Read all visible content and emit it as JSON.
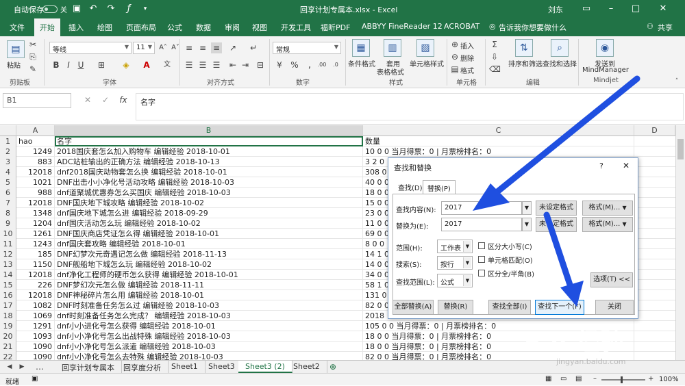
{
  "titlebar": {
    "autosave": "自动保存",
    "autosave_state": "关",
    "title": "回享计划专属本.xlsx  -  Excel",
    "user": "刘东"
  },
  "menu": {
    "tabs": [
      "文件",
      "开始",
      "插入",
      "绘图",
      "页面布局",
      "公式",
      "数据",
      "审阅",
      "视图",
      "开发工具",
      "福昕PDF",
      "ABBYY FineReader 12",
      "ACROBAT"
    ],
    "tell_me": "告诉我你想要做什么",
    "share": "共享",
    "active": "开始"
  },
  "ribbon": {
    "paste": "粘贴",
    "clipboard": "剪贴板",
    "font_name": "等线",
    "font_size": "11",
    "font_group": "字体",
    "align_group": "对齐方式",
    "number_format": "常规",
    "number_group": "数字",
    "conditional": "条件格式",
    "table_format_1": "套用",
    "table_format_2": "表格格式",
    "cell_style": "单元格样式",
    "style_group": "样式",
    "insert": "插入",
    "delete": "删除",
    "format": "格式",
    "cells_group": "单元格",
    "sort": "排序和筛选",
    "find": "查找和选择",
    "edit_group": "编辑",
    "send_1": "发送到",
    "send_2": "MindManager",
    "mindjet_group": "Mindjet"
  },
  "formula": {
    "namebox": "B1",
    "fx": "fx",
    "content": "名字"
  },
  "columns": [
    "A",
    "B",
    "C",
    "D"
  ],
  "header_row": {
    "a": "hao",
    "b": "名字",
    "c": "数量"
  },
  "rows": [
    {
      "n": "2",
      "a": "1249",
      "b": "2018国庆套怎么加入购物车 编辑经验 2018-10-01",
      "c": "10 0 0 当月得票：0 | 月票榜排名：0"
    },
    {
      "n": "3",
      "a": "883",
      "b": "ADC站桩输出的正确方法 编辑经验 2018-10-13",
      "c": "3 2 0"
    },
    {
      "n": "4",
      "a": "12018",
      "b": "dnf2018国庆动物套怎么换 编辑经验 2018-10-01",
      "c": "308 0"
    },
    {
      "n": "5",
      "a": "1021",
      "b": "DNF出击小小净化号活动攻略 编辑经验 2018-10-03",
      "c": "40 0 0"
    },
    {
      "n": "6",
      "a": "988",
      "b": "dnf道聚城优惠券怎么买国庆 编辑经验 2018-10-03",
      "c": "18 0 0"
    },
    {
      "n": "7",
      "a": "12018",
      "b": "DNF国庆地下城攻略 编辑经验 2018-10-02",
      "c": "15 0 0"
    },
    {
      "n": "8",
      "a": "1348",
      "b": "dnf国庆地下城怎么进 编辑经验 2018-09-29",
      "c": "23 0 0"
    },
    {
      "n": "9",
      "a": "1204",
      "b": "dnf国庆活动怎么玩 编辑经验 2018-10-02",
      "c": "11 0 0"
    },
    {
      "n": "10",
      "a": "1261",
      "b": "DNF国庆商店凭证怎么得 编辑经验 2018-10-01",
      "c": "69 0 0"
    },
    {
      "n": "11",
      "a": "1243",
      "b": "dnf国庆套攻略 编辑经验 2018-10-01",
      "c": "8 0 0"
    },
    {
      "n": "12",
      "a": "185",
      "b": "DNF幻梦次元奇遇记怎么做 编辑经验 2018-11-13",
      "c": "14 1 0"
    },
    {
      "n": "13",
      "a": "1150",
      "b": "DNF舰船地下城怎么玩 编辑经验 2018-10-02",
      "c": "14 0 0"
    },
    {
      "n": "14",
      "a": "12018",
      "b": "dnf净化工程师的硬币怎么获得 编辑经验 2018-10-01",
      "c": "34 0 0"
    },
    {
      "n": "15",
      "a": "226",
      "b": "DNF梦幻次元怎么做 编辑经验 2018-11-11",
      "c": "58 1 0"
    },
    {
      "n": "16",
      "a": "12018",
      "b": "DNF神秘碎片怎么用 编辑经验 2018-10-01",
      "c": "131 0"
    },
    {
      "n": "17",
      "a": "1082",
      "b": "DNF时刻准备任务怎么过 编辑经验 2018-10-03",
      "c": "82 0 0"
    },
    {
      "n": "18",
      "a": "1069",
      "b": "dnf时刻准备任务怎么完成？ 编辑经验 2018-10-03",
      "c": "2018"
    },
    {
      "n": "19",
      "a": "1291",
      "b": "dnf小小进化号怎么获得 编辑经验 2018-10-01",
      "c": "105 0 0 当月得票：0 | 月票榜排名：0"
    },
    {
      "n": "20",
      "a": "1093",
      "b": "dnf小小净化号怎么出战特殊 编辑经验 2018-10-03",
      "c": "18 0 0 当月得票：0 | 月票榜排名：0"
    },
    {
      "n": "21",
      "a": "1090",
      "b": "dnf小小净化号怎么派遣 编辑经验 2018-10-03",
      "c": "18 0 0 当月得票：0 | 月票榜排名：0"
    },
    {
      "n": "22",
      "a": "1090",
      "b": "dnf小小净化号怎么去特殊 编辑经验 2018-10-03",
      "c": "82 0 0 当月得票：0 | 月票榜排名：0"
    }
  ],
  "sheets": [
    "回享计划专属本",
    "回享度分析",
    "Sheet1",
    "Sheet3",
    "Sheet3 (2)",
    "Sheet2"
  ],
  "active_sheet": "Sheet3 (2)",
  "status": {
    "ready": "就绪",
    "zoom": "100%"
  },
  "dialog": {
    "title": "查找和替换",
    "help": "?",
    "close": "✕",
    "tab_find": "查找(D)",
    "tab_replace": "替换(P)",
    "find_label": "查找内容(N):",
    "find_value": "2017",
    "replace_label": "替换为(E):",
    "replace_value": "2017",
    "no_format": "未设定格式",
    "format_btn": "格式(M)...",
    "within_label": "范围(H):",
    "within_value": "工作表",
    "search_label": "搜索(S):",
    "search_value": "按行",
    "lookin_label": "查找范围(L):",
    "lookin_value": "公式",
    "match_case": "区分大小写(C)",
    "match_cell": "单元格匹配(O)",
    "match_width": "区分全/半角(B)",
    "options": "选项(T) <<",
    "replace_all": "全部替换(A)",
    "replace": "替换(R)",
    "find_all": "查找全部(I)",
    "find_next": "查找下一个(F)",
    "close_btn": "关闭"
  },
  "watermark": {
    "main": "Bai 经验",
    "sub": "jingyan.baidu.com"
  }
}
